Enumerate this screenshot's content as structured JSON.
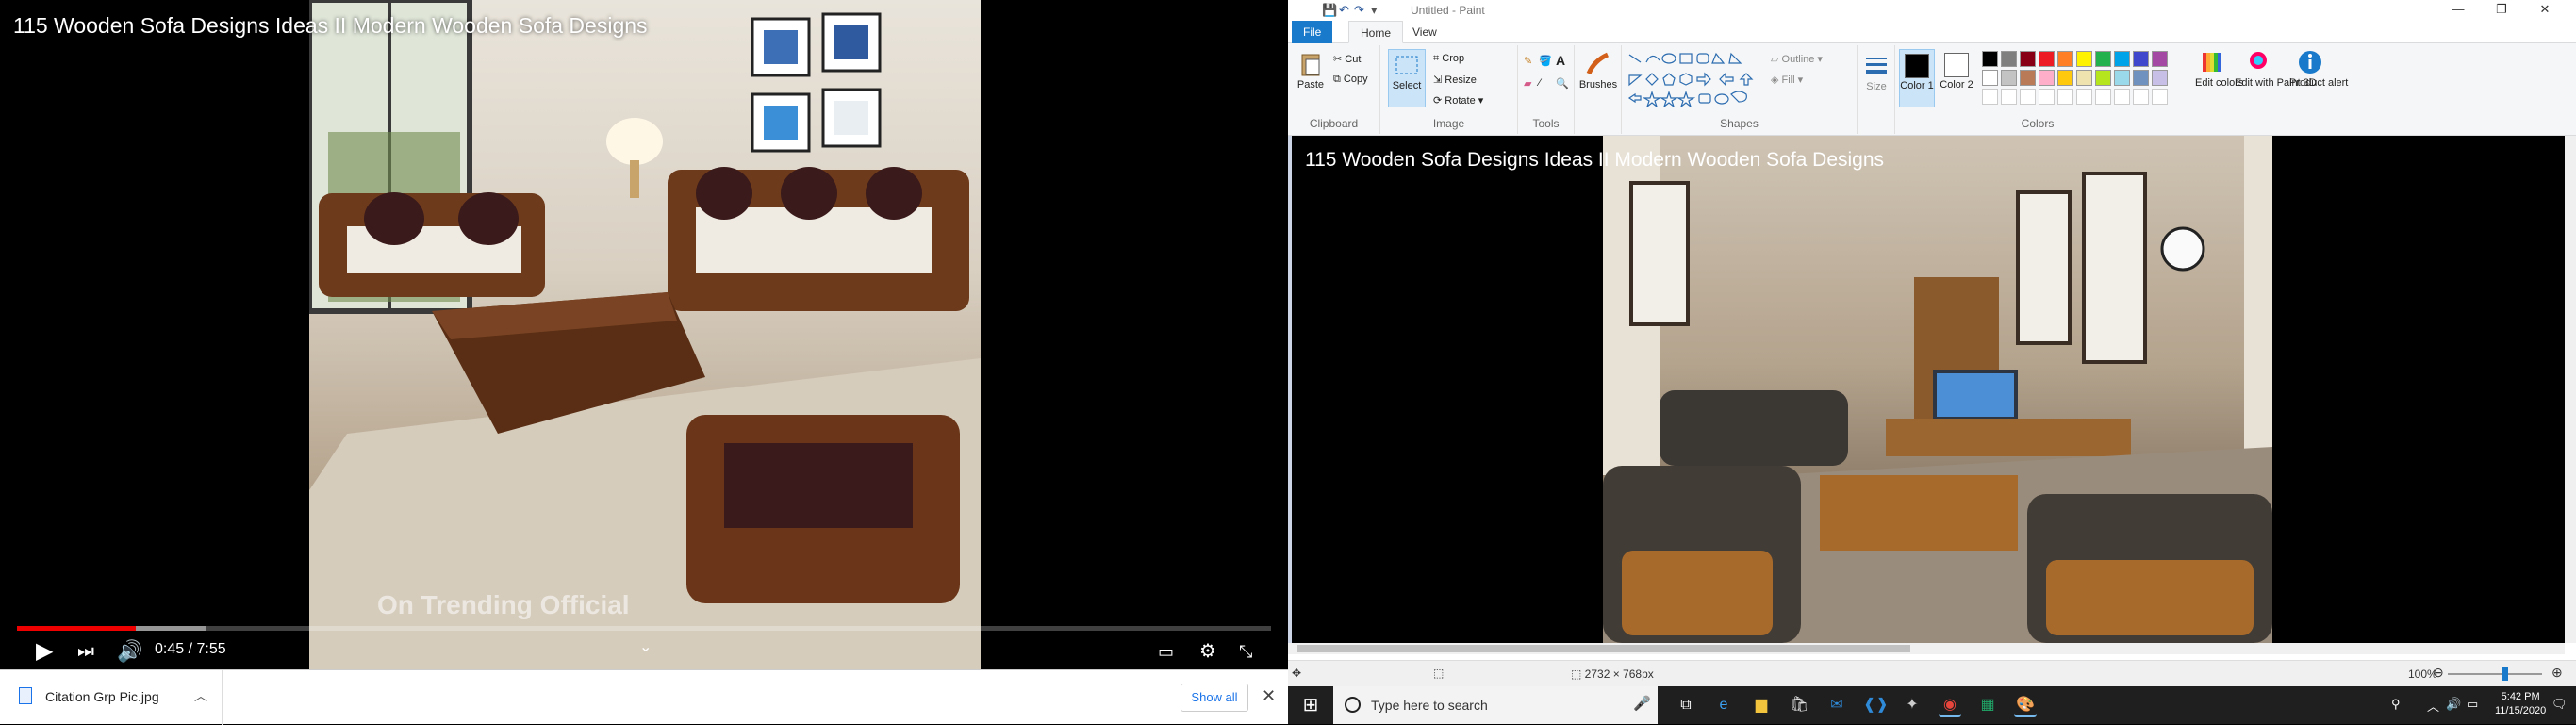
{
  "video": {
    "title": "115 Wooden Sofa Designs Ideas II Modern Wooden Sofa Designs",
    "watermark": "On Trending Official",
    "time": "0:45 / 7:55",
    "progress_played": 0.095,
    "progress_loaded": 0.15,
    "controls": {
      "play": "play-icon",
      "next": "next-icon",
      "volume": "volume-icon",
      "collapse": "chevron-down-icon",
      "captions": "captions-icon",
      "settings": "gear-icon",
      "exit_fullscreen": "exit-fullscreen-icon"
    }
  },
  "downloads": {
    "file_name": "Citation Grp Pic.jpg",
    "show_all": "Show all"
  },
  "paint": {
    "window_title": "Untitled - Paint",
    "tabs": [
      "File",
      "Home",
      "View"
    ],
    "clipboard": {
      "paste": "Paste",
      "cut": "Cut",
      "copy": "Copy",
      "label": "Clipboard"
    },
    "image": {
      "select": "Select",
      "crop": "Crop",
      "resize": "Resize",
      "rotate": "Rotate",
      "label": "Image"
    },
    "tools": {
      "label": "Tools"
    },
    "brushes": "Brushes",
    "shapes": {
      "outline": "Outline",
      "fill": "Fill",
      "label": "Shapes"
    },
    "size": "Size",
    "color1": "Color 1",
    "color2": "Color 2",
    "colors_label": "Colors",
    "edit_colors": "Edit colors",
    "edit_3d": "Edit with Paint 3D",
    "product_alert": "Product alert",
    "palette": [
      "#000000",
      "#7f7f7f",
      "#880015",
      "#ed1c24",
      "#ff7f27",
      "#fff200",
      "#22b14c",
      "#00a2e8",
      "#3f48cc",
      "#a349a4",
      "#ffffff",
      "#c3c3c3",
      "#b97a57",
      "#ffaec9",
      "#ffc90e",
      "#efe4b0",
      "#b5e61d",
      "#99d9ea",
      "#7092be",
      "#c8bfe7"
    ],
    "canvas_title": "115 Wooden Sofa Designs Ideas II Modern Wooden Sofa Designs",
    "dimensions": "2732 × 768px",
    "zoom": "100%"
  },
  "taskbar": {
    "search_placeholder": "Type here to search",
    "time": "5:42 PM",
    "date": "11/15/2020"
  }
}
